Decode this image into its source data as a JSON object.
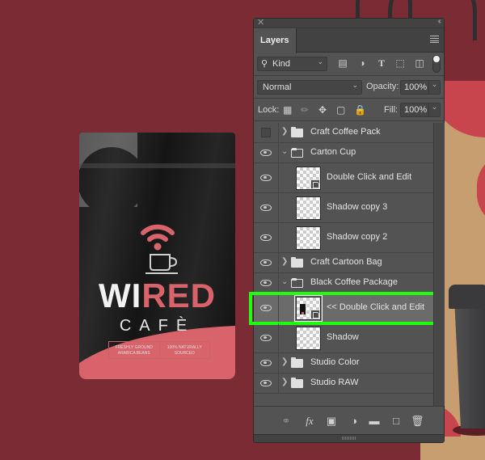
{
  "canvas": {
    "background_color": "#7a2b34",
    "pouch": {
      "brand_white": "WI",
      "brand_red": "RED",
      "subbrand": "CAFÈ",
      "tagline_left": "FRESHLY GROUND ARABICA BEANS",
      "tagline_right": "100% NATURALLY SOURCED",
      "accent_color": "#d9636b"
    }
  },
  "panel": {
    "close_icon": "close-icon",
    "collapse_icon": "double-chevron-left-icon",
    "tab_label": "Layers",
    "menu_icon": "panel-menu-icon",
    "filter": {
      "search_icon": "search-icon",
      "kind_label": "Kind",
      "filter_icons": [
        "pixel-layer-filter-icon",
        "adjustment-layer-filter-icon",
        "type-layer-filter-icon",
        "shape-layer-filter-icon",
        "smart-object-filter-icon"
      ],
      "type_glyph": "T"
    },
    "blend_mode": "Normal",
    "opacity_label": "Opacity:",
    "opacity_value": "100%",
    "lock_label": "Lock:",
    "lock_icons": [
      "lock-transparent-pixels-icon",
      "lock-image-pixels-icon",
      "lock-position-icon",
      "lock-artboard-icon",
      "lock-all-icon"
    ],
    "fill_label": "Fill:",
    "fill_value": "100%",
    "layers": [
      {
        "name": "Craft Coffee Pack",
        "type": "group",
        "visible": false,
        "expanded": false,
        "indent": 0
      },
      {
        "name": "Carton Cup",
        "type": "group",
        "visible": true,
        "expanded": true,
        "indent": 0
      },
      {
        "name": "Double Click and Edit",
        "type": "smart-object",
        "visible": true,
        "indent": 1
      },
      {
        "name": "Shadow copy 3",
        "type": "pixel",
        "visible": true,
        "indent": 1
      },
      {
        "name": "Shadow copy 2",
        "type": "pixel",
        "visible": true,
        "indent": 1
      },
      {
        "name": "Craft Cartoon Bag",
        "type": "group",
        "visible": true,
        "expanded": false,
        "indent": 0
      },
      {
        "name": "Black Coffee Package",
        "type": "group",
        "visible": true,
        "expanded": true,
        "indent": 0
      },
      {
        "name": "<< Double Click and Edit",
        "type": "smart-object",
        "visible": true,
        "indent": 1,
        "selected": true,
        "highlighted": true
      },
      {
        "name": "Shadow",
        "type": "pixel",
        "visible": true,
        "indent": 1
      },
      {
        "name": "Studio Color",
        "type": "group",
        "visible": true,
        "expanded": false,
        "indent": 0
      },
      {
        "name": "Studio RAW",
        "type": "group",
        "visible": true,
        "expanded": false,
        "indent": 0
      }
    ],
    "highlight_color": "#1dff0f",
    "footer_icons": [
      "link-layers-icon",
      "layer-style-fx-icon",
      "add-mask-icon",
      "adjustment-layer-icon",
      "new-group-icon",
      "new-layer-icon",
      "delete-layer-icon"
    ],
    "fx_label": "fx"
  }
}
